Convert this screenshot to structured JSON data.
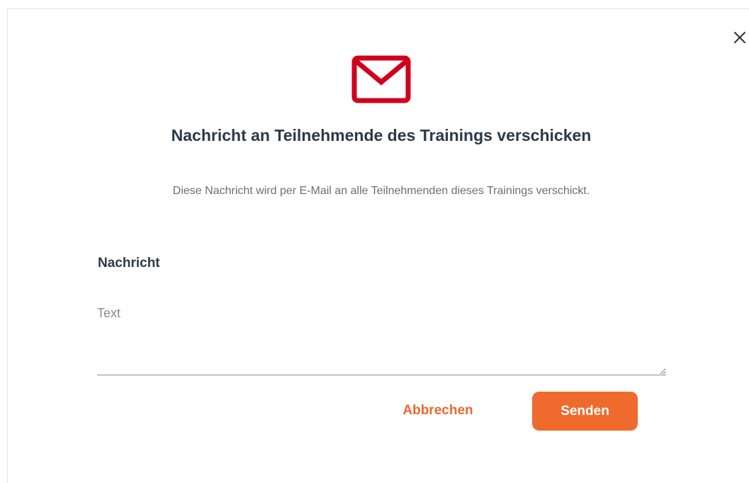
{
  "dialog": {
    "title": "Nachricht an Teilnehmende des Trainings verschicken",
    "subtitle": "Diese Nachricht wird per E-Mail an alle Teilnehmenden dieses Trainings verschickt.",
    "header_icon": "envelope-icon",
    "close_icon": "close-icon"
  },
  "form": {
    "message_label": "Nachricht",
    "message_placeholder": "Text",
    "message_value": ""
  },
  "actions": {
    "cancel_label": "Abbrechen",
    "send_label": "Senden"
  },
  "colors": {
    "accent": "#ef6a2d",
    "cancel_text": "#e8692e",
    "icon_red": "#d0021b",
    "heading": "#2c3a47",
    "body_text": "#6b6f73"
  }
}
